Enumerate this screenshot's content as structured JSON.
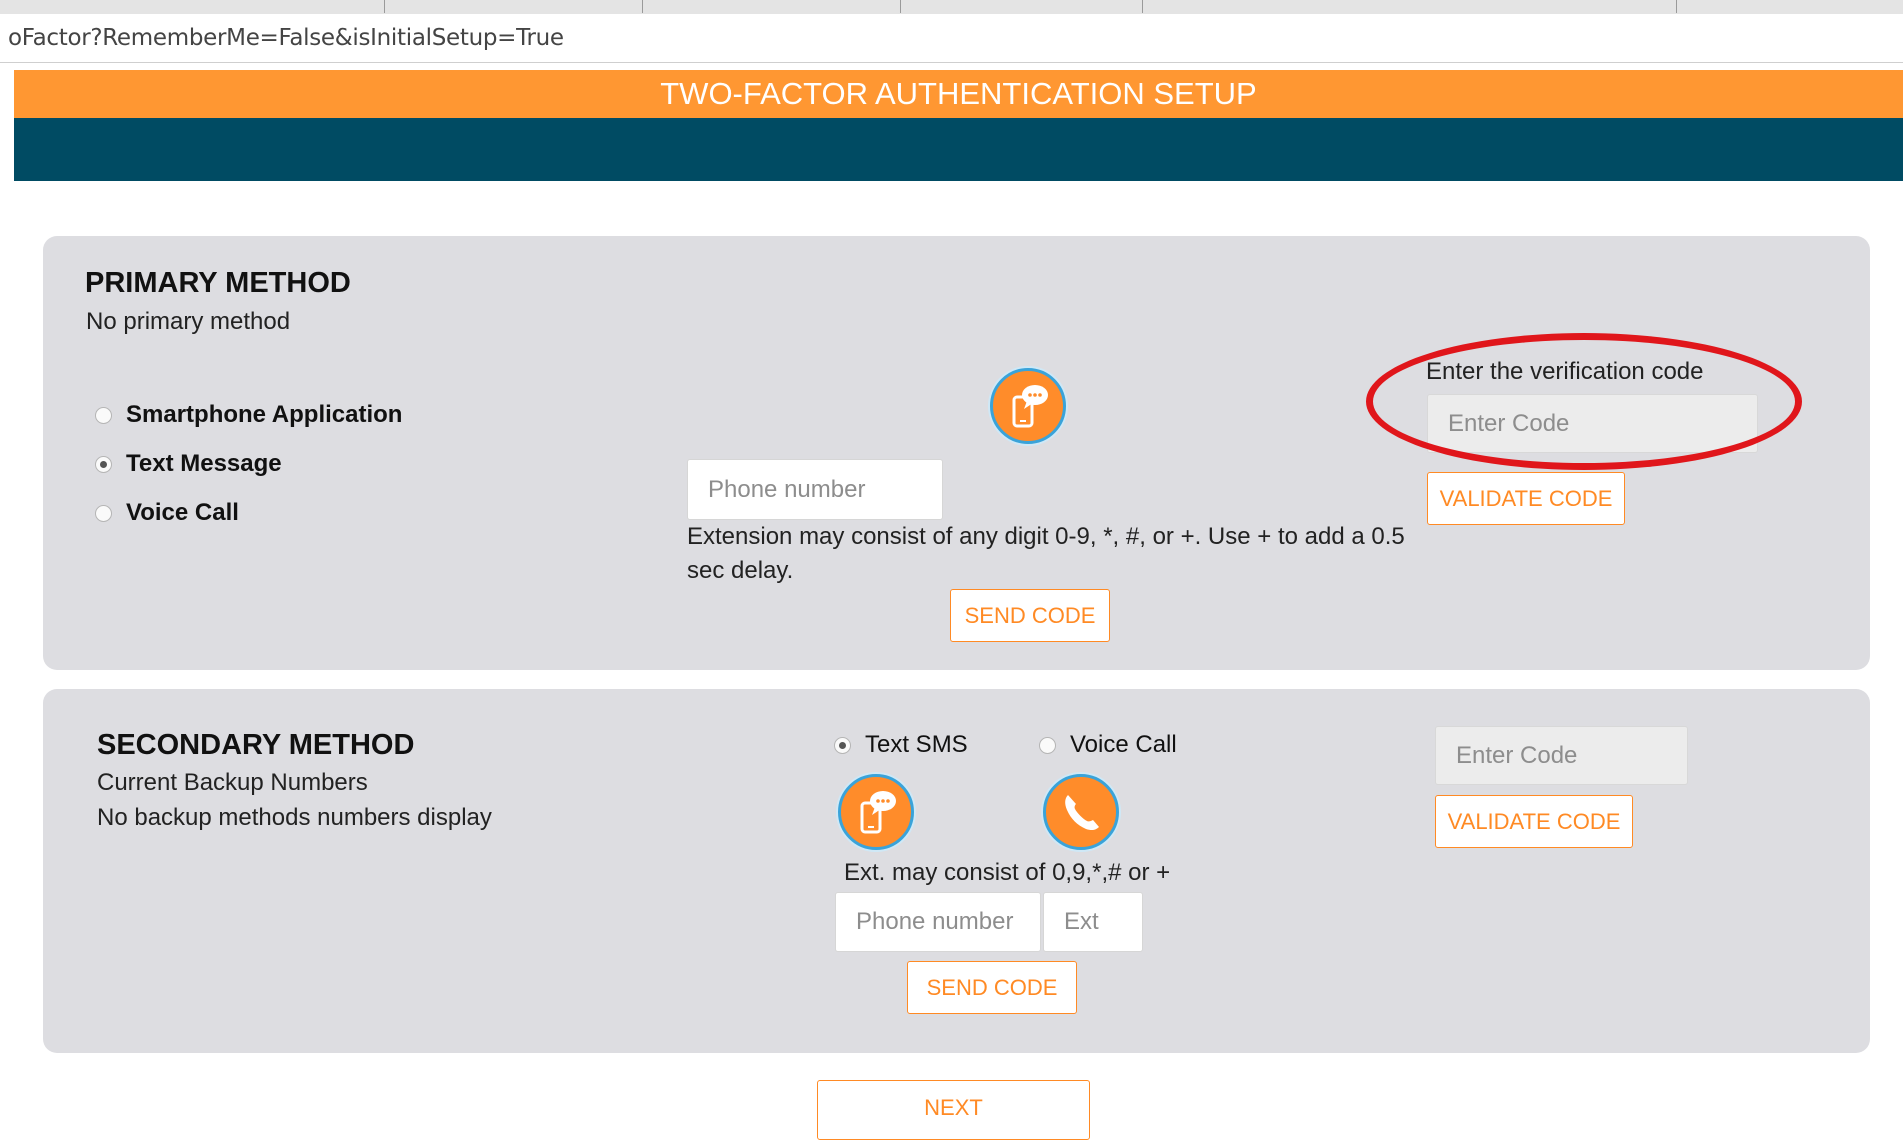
{
  "browser": {
    "url": "oFactor?RememberMe=False&isInitialSetup=True"
  },
  "header": {
    "title": "TWO-FACTOR AUTHENTICATION SETUP"
  },
  "primary": {
    "heading": "PRIMARY METHOD",
    "status": "No primary method",
    "options": [
      {
        "label": "Smartphone Application",
        "selected": false
      },
      {
        "label": "Text Message",
        "selected": true
      },
      {
        "label": "Voice Call",
        "selected": false
      }
    ],
    "icon": "sms-phone-icon",
    "phone_placeholder": "Phone number",
    "extension_help": "Extension may consist of any digit 0-9, *, #, or +. Use + to add a 0.5 sec delay.",
    "send_label": "SEND CODE",
    "verify_label": "Enter the verification code",
    "code_placeholder": "Enter Code",
    "validate_label": "VALIDATE CODE"
  },
  "secondary": {
    "heading": "SECONDARY METHOD",
    "backup_title": "Current Backup Numbers",
    "backup_status": "No backup methods numbers display",
    "options": [
      {
        "label": "Text SMS",
        "selected": true,
        "icon": "sms-phone-icon"
      },
      {
        "label": "Voice Call",
        "selected": false,
        "icon": "phone-call-icon"
      }
    ],
    "ext_help": "Ext. may consist of 0,9,*,# or +",
    "phone_placeholder": "Phone number",
    "ext_placeholder": "Ext",
    "send_label": "SEND CODE",
    "code_placeholder": "Enter Code",
    "validate_label": "VALIDATE CODE"
  },
  "footer": {
    "next_label": "NEXT"
  },
  "annotation": {
    "color": "#e0161b"
  },
  "theme": {
    "accent": "#ff9732",
    "navy": "#004b63",
    "panel": "#dddde1"
  }
}
